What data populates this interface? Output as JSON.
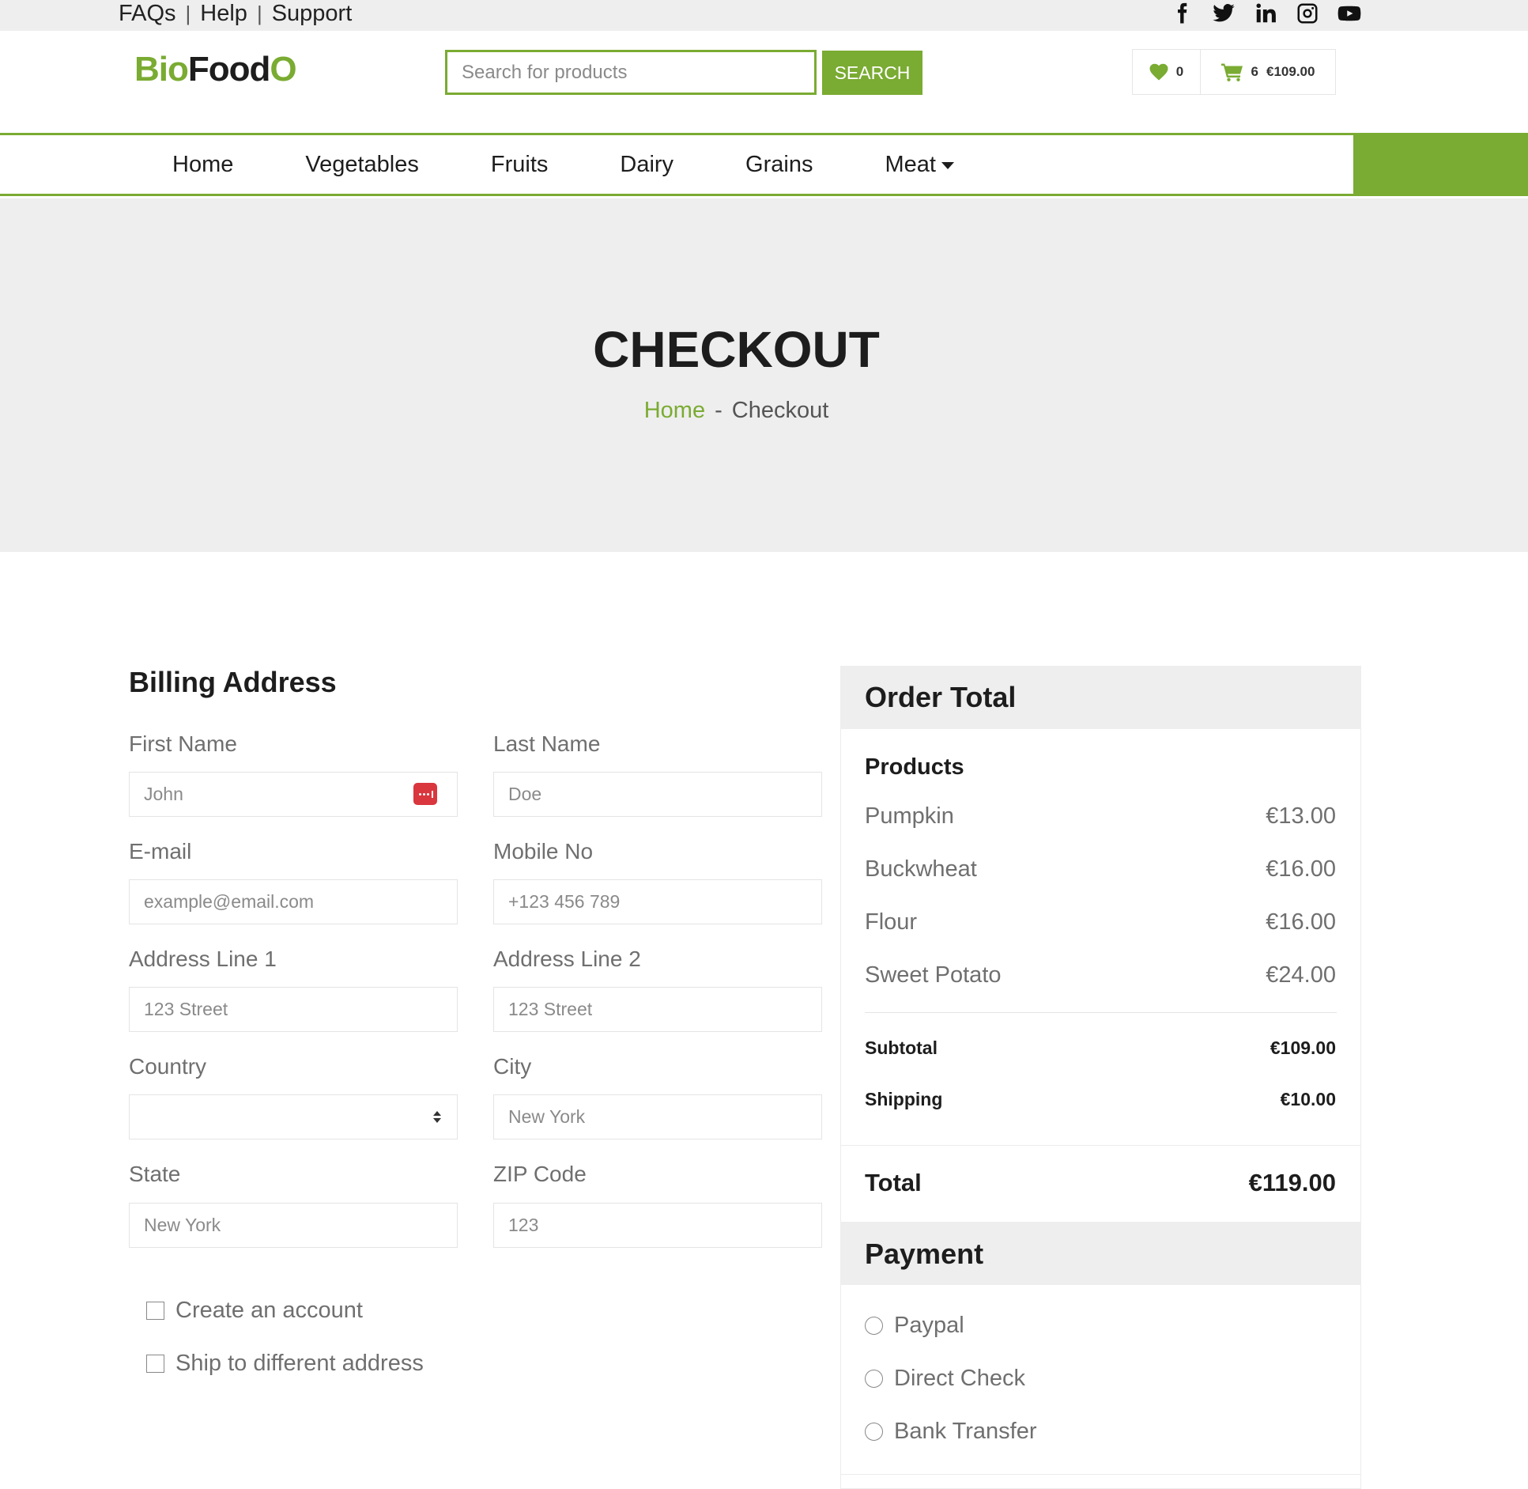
{
  "topbar": {
    "links": [
      "FAQs",
      "Help",
      "Support"
    ],
    "separator": "|",
    "socials": [
      "facebook-icon",
      "twitter-icon",
      "linkedin-icon",
      "instagram-icon",
      "youtube-icon"
    ]
  },
  "header": {
    "logo": {
      "part1": "Bio",
      "part2": "Food",
      "part3": "O"
    },
    "search": {
      "placeholder": "Search for products",
      "button": "SEARCH"
    },
    "wishlist_count": "0",
    "cart_count": "6",
    "cart_total": "€109.00"
  },
  "nav": {
    "items": [
      "Home",
      "Vegetables",
      "Fruits",
      "Dairy",
      "Grains",
      "Meat"
    ]
  },
  "hero": {
    "title": "CHECKOUT",
    "breadcrumb_home": "Home",
    "breadcrumb_sep": "-",
    "breadcrumb_current": "Checkout"
  },
  "billing": {
    "title": "Billing Address",
    "fields": {
      "first_name": {
        "label": "First Name",
        "placeholder": "John"
      },
      "last_name": {
        "label": "Last Name",
        "placeholder": "Doe"
      },
      "email": {
        "label": "E-mail",
        "placeholder": "example@email.com"
      },
      "mobile": {
        "label": "Mobile No",
        "placeholder": "+123 456 789"
      },
      "address1": {
        "label": "Address Line 1",
        "placeholder": "123 Street"
      },
      "address2": {
        "label": "Address Line 2",
        "placeholder": "123 Street"
      },
      "country": {
        "label": "Country",
        "value": ""
      },
      "city": {
        "label": "City",
        "placeholder": "New York"
      },
      "state": {
        "label": "State",
        "placeholder": "New York"
      },
      "zip": {
        "label": "ZIP Code",
        "placeholder": "123"
      }
    },
    "create_account": "Create an account",
    "ship_different": "Ship to different address"
  },
  "order": {
    "title": "Order Total",
    "products_title": "Products",
    "products": [
      {
        "name": "Pumpkin",
        "price": "€13.00"
      },
      {
        "name": "Buckwheat",
        "price": "€16.00"
      },
      {
        "name": "Flour",
        "price": "€16.00"
      },
      {
        "name": "Sweet Potato",
        "price": "€24.00"
      }
    ],
    "subtotal_label": "Subtotal",
    "subtotal": "€109.00",
    "shipping_label": "Shipping",
    "shipping": "€10.00",
    "total_label": "Total",
    "total": "€119.00"
  },
  "payment": {
    "title": "Payment",
    "options": [
      "Paypal",
      "Direct Check",
      "Bank Transfer"
    ]
  },
  "colors": {
    "accent": "#7aab32",
    "hero_bg": "#eeeeee",
    "password_icon": "#d9363e"
  }
}
